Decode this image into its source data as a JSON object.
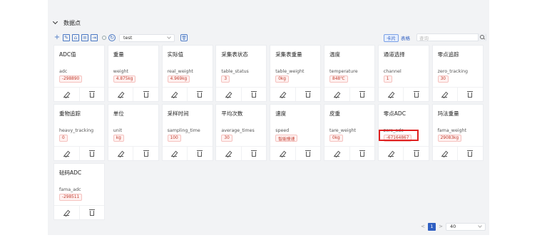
{
  "panel": {
    "title": "数据点"
  },
  "toolbar": {
    "selected_device": "test",
    "view_card_label": "卡片",
    "view_table_label": "表格",
    "search_placeholder": "查询"
  },
  "cards": [
    {
      "title": "ADC值",
      "field": "adc",
      "value": "-298890"
    },
    {
      "title": "重量",
      "field": "weight",
      "value": "4.875kg"
    },
    {
      "title": "实际值",
      "field": "real_weight",
      "value": "4.969kg"
    },
    {
      "title": "采集表状态",
      "field": "table_status",
      "value": "3"
    },
    {
      "title": "采集表重量",
      "field": "table_weight",
      "value": "0kg"
    },
    {
      "title": "温度",
      "field": "temperature",
      "value": "848℃"
    },
    {
      "title": "通道选择",
      "field": "channel",
      "value": "1"
    },
    {
      "title": "零点追踪",
      "field": "zero_tracking",
      "value": "30"
    },
    {
      "title": "重物追踪",
      "field": "heavy_tracking",
      "value": "0"
    },
    {
      "title": "单位",
      "field": "unit",
      "value": "kg"
    },
    {
      "title": "采样时间",
      "field": "sampling_time",
      "value": "100"
    },
    {
      "title": "平均次数",
      "field": "average_times",
      "value": "30"
    },
    {
      "title": "速度",
      "field": "speed",
      "value": "智能慢速"
    },
    {
      "title": "皮重",
      "field": "tare_weight",
      "value": "0kg"
    },
    {
      "title": "零点ADC",
      "field": "zero_adc",
      "value": "-67164867"
    },
    {
      "title": "玛法重量",
      "field": "fama_weight",
      "value": "29083kg"
    },
    {
      "title": "砝码ADC",
      "field": "fama_adc",
      "value": "-298511"
    }
  ],
  "pagination": {
    "current_page": "1",
    "page_size": "40",
    "prev": "<",
    "next": ">"
  },
  "colors": {
    "accent": "#2f5fc2",
    "tag_text": "#c0392b",
    "tag_bg": "#fff1f0",
    "highlight": "#e02020"
  }
}
